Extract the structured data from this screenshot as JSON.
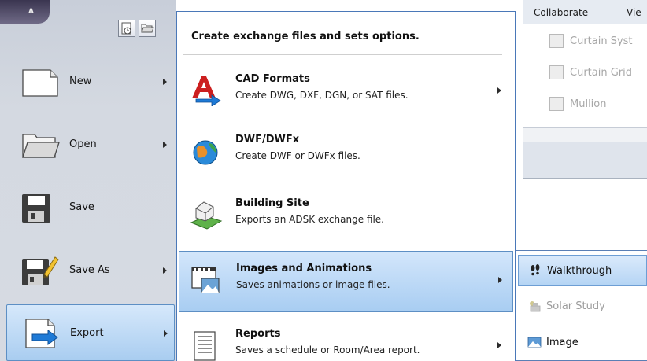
{
  "ribbon": {
    "tabs": [
      "Collaborate",
      "Vie"
    ],
    "items": [
      "Curtain Syst",
      "Curtain Grid",
      "Mullion"
    ]
  },
  "app_menu": {
    "logo_letter": "A",
    "items": [
      {
        "label": "New",
        "has_arrow": true,
        "icon": "new-document-icon"
      },
      {
        "label": "Open",
        "has_arrow": true,
        "icon": "folder-open-icon"
      },
      {
        "label": "Save",
        "has_arrow": false,
        "icon": "floppy-disk-icon"
      },
      {
        "label": "Save As",
        "has_arrow": true,
        "icon": "save-as-icon"
      },
      {
        "label": "Export",
        "has_arrow": true,
        "icon": "export-icon",
        "active": true
      }
    ]
  },
  "export_menu": {
    "header": "Create exchange files and sets options.",
    "items": [
      {
        "title": "CAD Formats",
        "desc": "Create DWG, DXF, DGN, or SAT files.",
        "has_arrow": true,
        "icon": "cad-formats-icon"
      },
      {
        "title": "DWF/DWFx",
        "desc": "Create DWF or DWFx files.",
        "has_arrow": false,
        "icon": "dwf-globe-icon"
      },
      {
        "title": "Building Site",
        "desc": "Exports an ADSK exchange file.",
        "has_arrow": false,
        "icon": "building-site-icon"
      },
      {
        "title": "Images and Animations",
        "desc": "Saves animations or image files.",
        "has_arrow": true,
        "icon": "film-strip-icon",
        "active": true
      },
      {
        "title": "Reports",
        "desc": "Saves a schedule or Room/Area report.",
        "has_arrow": true,
        "icon": "report-icon"
      }
    ]
  },
  "flyout": {
    "items": [
      {
        "label": "Walkthrough",
        "icon": "footprints-icon",
        "active": true
      },
      {
        "label": "Solar Study",
        "icon": "solar-study-icon",
        "disabled": true
      },
      {
        "label": "Image",
        "icon": "image-icon"
      }
    ]
  },
  "colors": {
    "accent_border": "#4a78b8",
    "highlight_top": "#d3e6fb",
    "highlight_bottom": "#a8cdf2",
    "cad_red": "#cc1f1f",
    "export_blue": "#1e7ad6"
  }
}
